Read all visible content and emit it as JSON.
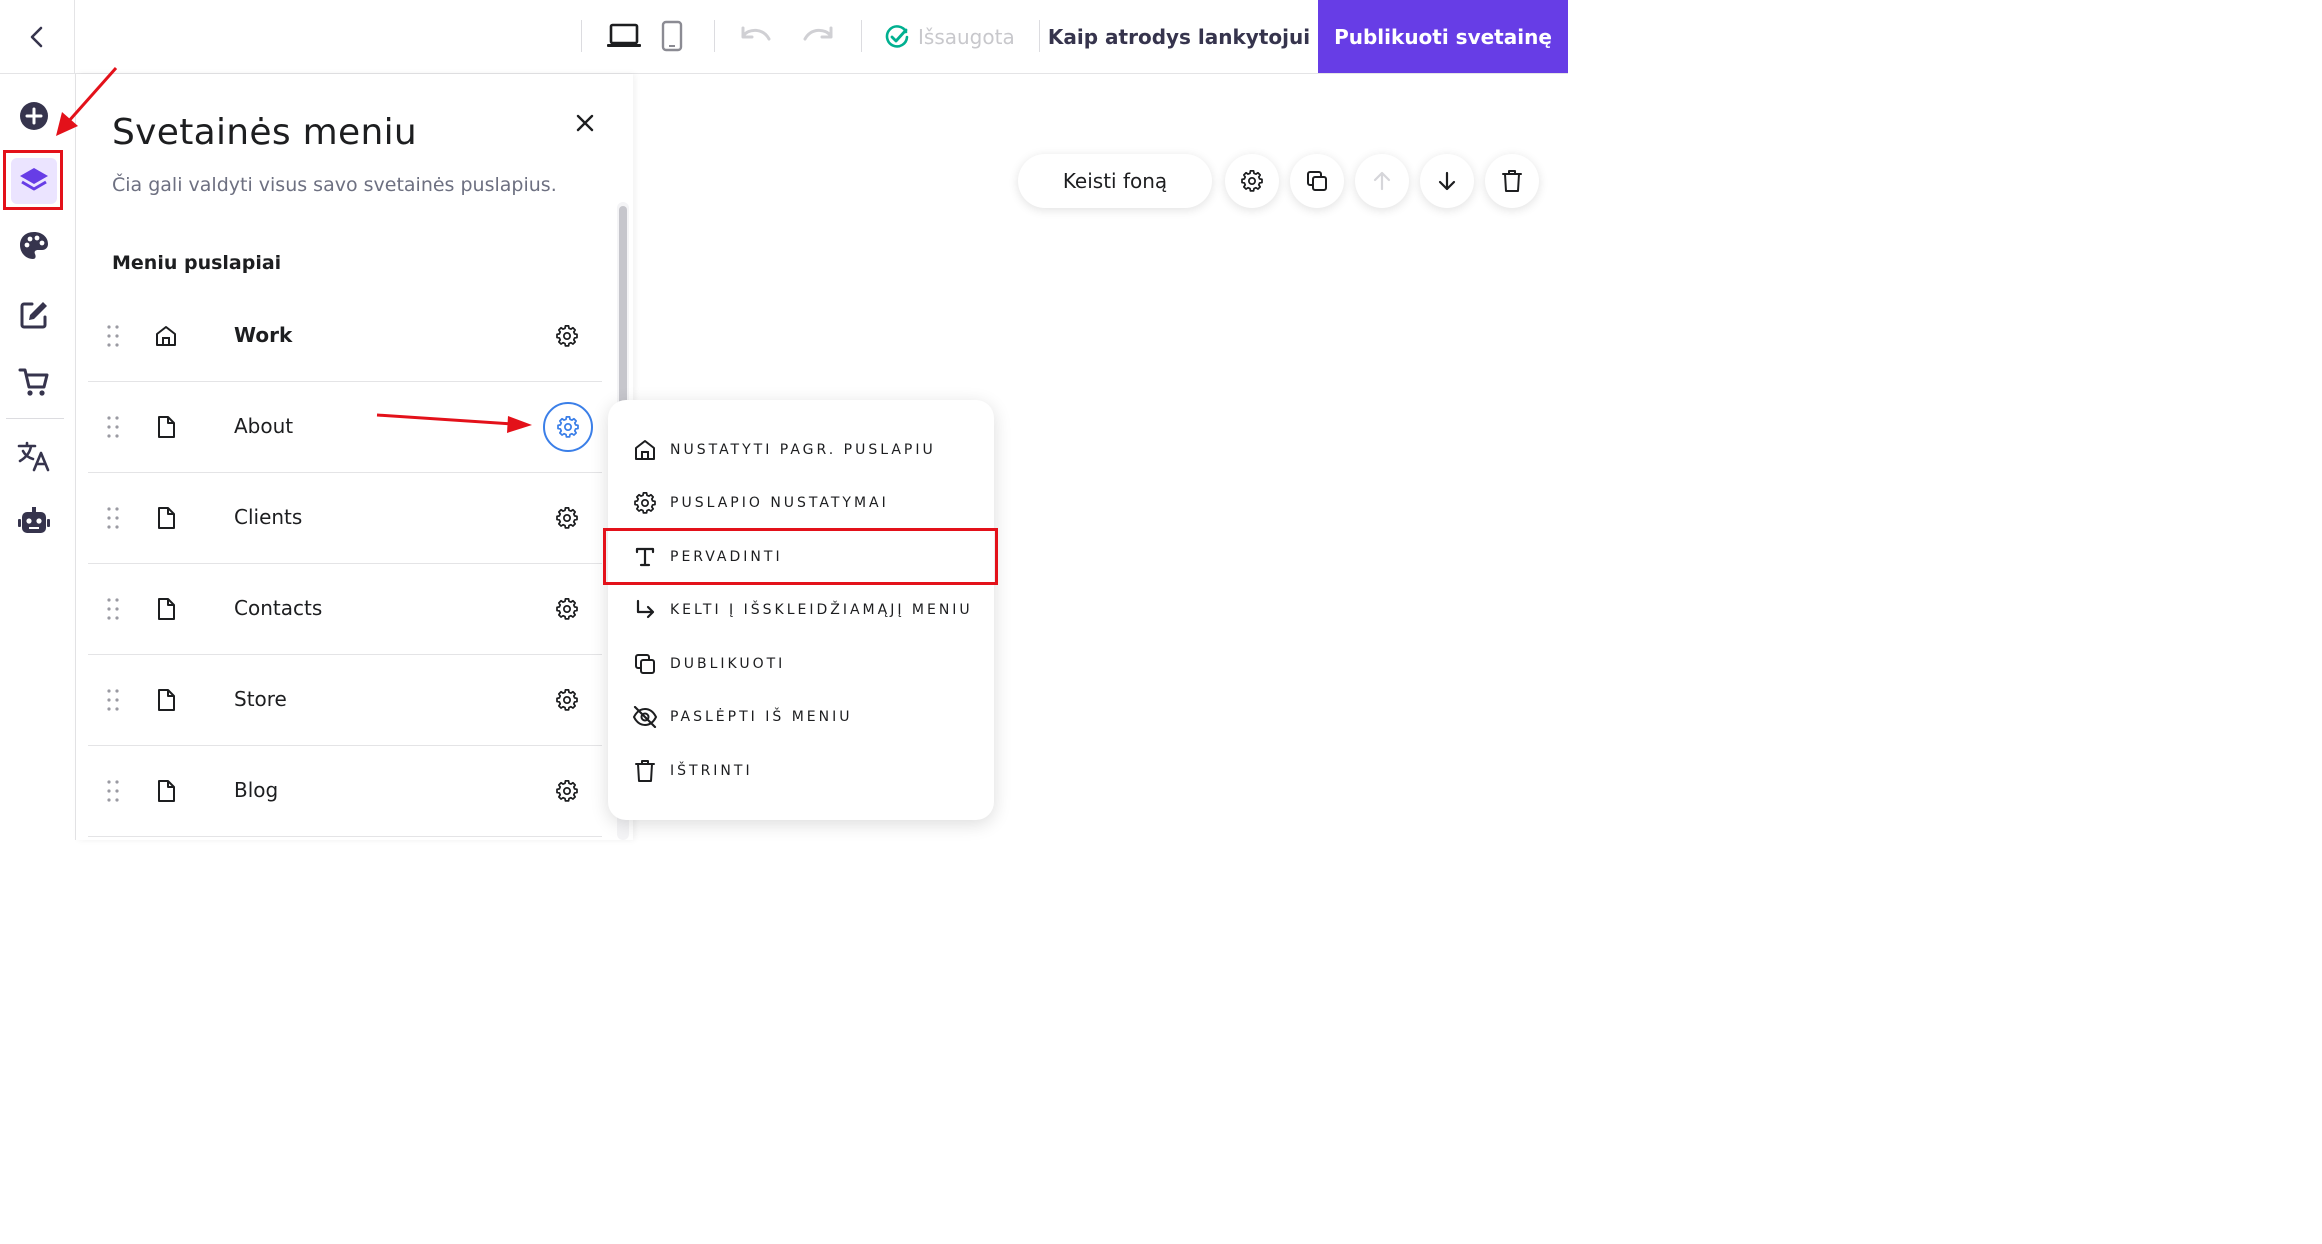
{
  "topbar": {
    "saved_label": "Išsaugota",
    "preview_label": "Kaip atrodys lankytojui",
    "publish_label": "Publikuoti svetainę"
  },
  "panel": {
    "title": "Svetainės meniu",
    "subtitle": "Čia gali valdyti visus savo svetainės puslapius.",
    "section_label": "Meniu puslapiai",
    "pages": [
      {
        "name": "Work",
        "icon": "home-icon"
      },
      {
        "name": "About",
        "icon": "file-icon"
      },
      {
        "name": "Clients",
        "icon": "file-icon"
      },
      {
        "name": "Contacts",
        "icon": "file-icon"
      },
      {
        "name": "Store",
        "icon": "file-icon"
      },
      {
        "name": "Blog",
        "icon": "file-icon"
      }
    ]
  },
  "canvas_toolbar": {
    "change_background_label": "Keisti foną"
  },
  "context_menu": {
    "items": [
      {
        "label": "NUSTATYTI PAGR. PUSLAPIU",
        "icon": "home-icon"
      },
      {
        "label": "PUSLAPIO NUSTATYMAI",
        "icon": "gear-icon"
      },
      {
        "label": "PERVADINTI",
        "icon": "text-icon"
      },
      {
        "label": "KELTI Į IŠSKLEIDŽIAMĄJĮ MENIU",
        "icon": "arrow-down-right-icon"
      },
      {
        "label": "DUBLIKUOTI",
        "icon": "duplicate-icon"
      },
      {
        "label": "PASLĖPTI IŠ MENIU",
        "icon": "eye-off-icon"
      },
      {
        "label": "IŠTRINTI",
        "icon": "trash-icon"
      }
    ]
  },
  "colors": {
    "accent": "#673de6",
    "annotation_red": "#e3111a",
    "saved_check": "#00b090",
    "selected_ring": "#3b7fe8"
  }
}
